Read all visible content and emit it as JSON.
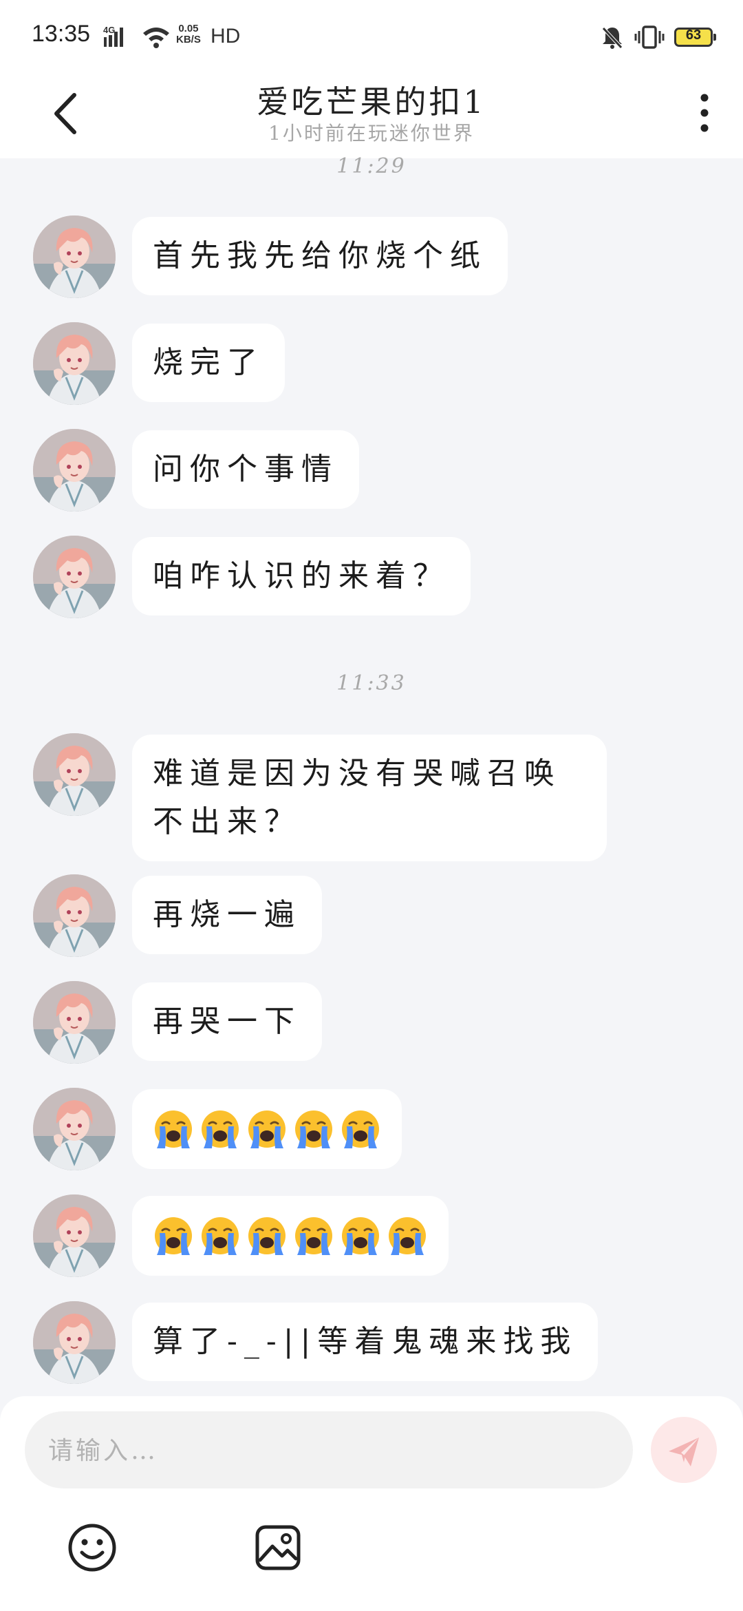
{
  "status_bar": {
    "time": "13:35",
    "network": "4G",
    "speed_value": "0.05",
    "speed_unit": "KB/S",
    "hd": "HD",
    "battery": "63"
  },
  "header": {
    "title": "爱吃芒果的扣1",
    "subtitle": "1小时前在玩迷你世界"
  },
  "chat": {
    "time_separators": [
      "11:29",
      "11:33"
    ],
    "messages": [
      {
        "text": "首先我先给你烧个纸"
      },
      {
        "text": "烧完了"
      },
      {
        "text": "问你个事情"
      },
      {
        "text": "咱咋认识的来着？"
      },
      {
        "text": "难道是因为没有哭喊召唤不出来？"
      },
      {
        "text": "再烧一遍"
      },
      {
        "text": "再哭一下"
      },
      {
        "emoji_count": 5,
        "emoji": "loudly-crying-face"
      },
      {
        "emoji_count": 6,
        "emoji": "loudly-crying-face"
      },
      {
        "text": "算了-_-||等着鬼魂来找我"
      }
    ]
  },
  "input": {
    "placeholder": "请输入…"
  },
  "colors": {
    "background": "#f4f5f8",
    "bubble": "#ffffff",
    "send_button": "#fde8e8",
    "send_icon": "#f3b3b3",
    "battery": "#f5e04a"
  }
}
